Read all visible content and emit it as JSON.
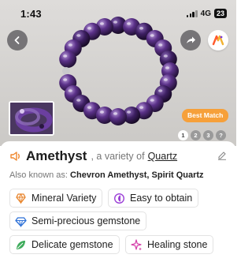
{
  "status_bar": {
    "time": "1:43",
    "network": "4G",
    "battery": "23"
  },
  "hero": {
    "icons": {
      "back": "chevron-left-icon",
      "share": "share-arrow-icon",
      "app": "app-logo-icon"
    },
    "best_match_label": "Best Match",
    "pages": [
      "1",
      "2",
      "3",
      "?"
    ],
    "active_page": "1"
  },
  "gem": {
    "name": "Amethyst",
    "variety_prefix": ", a variety of",
    "variety_link": "Quartz",
    "aka_label": "Also known as:",
    "aka_values": "Chevron Amethyst, Spirit Quartz"
  },
  "chips": [
    {
      "label": "Mineral Variety",
      "icon": "crystal-icon",
      "color": "#e8852d"
    },
    {
      "label": "Easy to obtain",
      "icon": "moon-icon",
      "color": "#9b3fd6"
    },
    {
      "label": "Semi-precious gemstone",
      "icon": "gem-icon",
      "color": "#2f72d8"
    },
    {
      "label": "Delicate gemstone",
      "icon": "leaf-icon",
      "color": "#2aa34a"
    },
    {
      "label": "Healing stone",
      "icon": "sparkle-icon",
      "color": "#d43ca8"
    }
  ],
  "colors": {
    "accent_orange": "#f6a03a",
    "background_hero": "#d6d5d3"
  }
}
